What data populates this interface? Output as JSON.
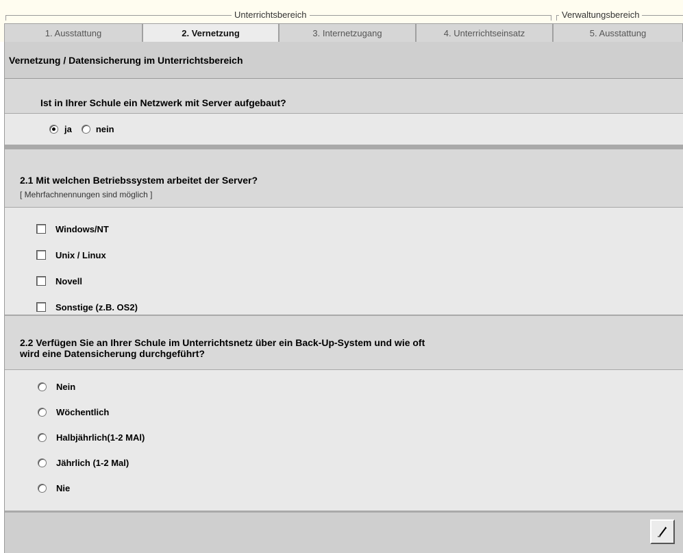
{
  "groups": {
    "teaching": "Unterrichtsbereich",
    "administration": "Verwaltungsbereich"
  },
  "tabs": [
    {
      "label": "1. Ausstattung"
    },
    {
      "label": "2. Vernetzung"
    },
    {
      "label": "3. Internetzugang"
    },
    {
      "label": "4. Unterrichtseinsatz"
    },
    {
      "label": "5. Ausstattung"
    }
  ],
  "active_tab": "2. Vernetzung",
  "page_title": "Vernetzung / Datensicherung im Unterrichtsbereich",
  "q_network": {
    "question": "Ist in Ihrer Schule ein Netzwerk mit Server aufgebaut?",
    "options": [
      "ja",
      "nein"
    ],
    "selected": "ja"
  },
  "q_os": {
    "question": "2.1 Mit welchen Betriebssystem arbeitet der Server?",
    "hint": "[ Mehrfachnennungen sind möglich ]",
    "options": [
      "Windows/NT",
      "Unix / Linux",
      "Novell",
      "Sonstige (z.B. OS2)"
    ],
    "checked": []
  },
  "q_backup": {
    "question_line1": "2.2 Verfügen Sie an Ihrer Schule im Unterrichtsnetz über ein Back-Up-System und wie oft",
    "question_line2": "wird eine Datensicherung durchgeführt?",
    "options": [
      "Nein",
      "Wöchentlich",
      "Halbjährlich(1-2 MAl)",
      "Jährlich (1-2 Mal)",
      "Nie"
    ],
    "selected": null
  },
  "icons": {
    "edit_button": "pencil-icon"
  }
}
